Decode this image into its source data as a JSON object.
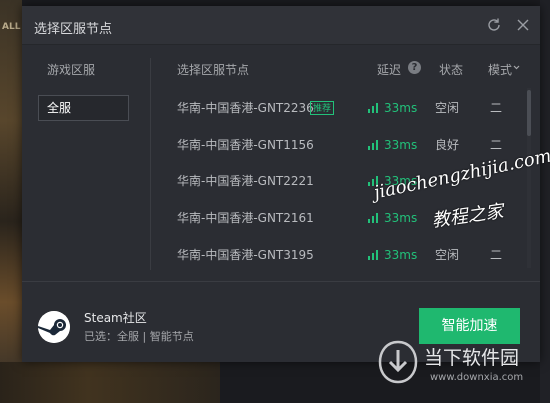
{
  "background": {
    "left_game_text": "ALL"
  },
  "dialog": {
    "title": "选择区服节点",
    "sidebar": {
      "header": "游戏区服",
      "items": [
        {
          "label": "全服",
          "selected": true
        }
      ]
    },
    "table": {
      "headers": {
        "node": "选择区服节点",
        "latency": "延迟",
        "status": "状态",
        "mode": "模式"
      },
      "rows": [
        {
          "name": "华南-中国香港-GNT2236",
          "badge": "推荐",
          "latency": "33ms",
          "status": "空闲",
          "mode": "二"
        },
        {
          "name": "华南-中国香港-GNT1156",
          "badge": "",
          "latency": "33ms",
          "status": "良好",
          "mode": "二"
        },
        {
          "name": "华南-中国香港-GNT2221",
          "badge": "",
          "latency": "33ms",
          "status": "",
          "mode": ""
        },
        {
          "name": "华南-中国香港-GNT2161",
          "badge": "",
          "latency": "33ms",
          "status": "",
          "mode": ""
        },
        {
          "name": "华南-中国香港-GNT3195",
          "badge": "",
          "latency": "33ms",
          "status": "空闲",
          "mode": "二"
        }
      ]
    },
    "footer": {
      "game_name": "Steam社区",
      "selected_text": "已选：全服 | 智能节点",
      "accelerate_label": "智能加速"
    }
  },
  "watermark": {
    "line1": "jiaochengzhijia.com",
    "line2": "教程之家"
  },
  "download_watermark": {
    "name": "当下软件园",
    "url": "www.downxia.com"
  },
  "colors": {
    "accent_green": "#1fb86f",
    "dialog_bg": "#2b2d33"
  }
}
